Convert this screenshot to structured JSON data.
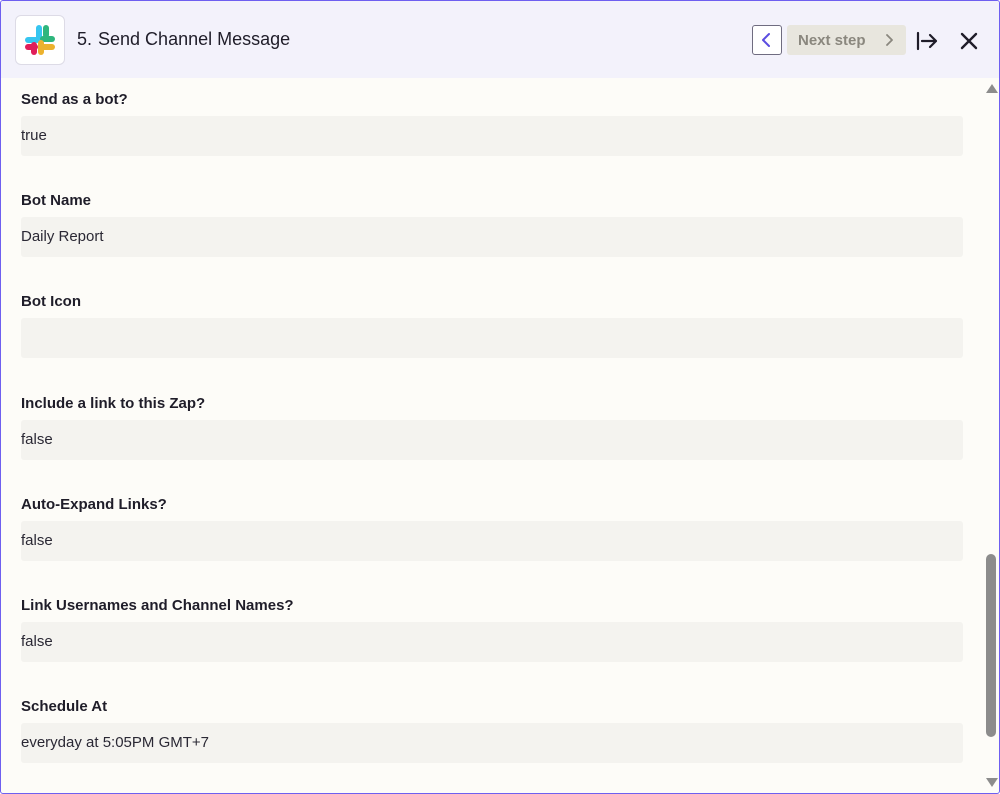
{
  "header": {
    "step_number": "5.",
    "step_title": "Send Channel Message",
    "next_label": "Next step",
    "app_icon": "slack-logo"
  },
  "fields": [
    {
      "label": "Send as a bot?",
      "value": "true"
    },
    {
      "label": "Bot Name",
      "value": "Daily Report"
    },
    {
      "label": "Bot Icon",
      "value": ""
    },
    {
      "label": "Include a link to this Zap?",
      "value": "false"
    },
    {
      "label": "Auto-Expand Links?",
      "value": "false"
    },
    {
      "label": "Link Usernames and Channel Names?",
      "value": "false"
    },
    {
      "label": "Schedule At",
      "value": "everyday at 5:05PM GMT+7"
    }
  ],
  "colors": {
    "accent": "#6e5ff0",
    "header_bg": "#f3f2fb",
    "panel_bg": "#fdfcf8",
    "field_bg": "#f4f3ef"
  }
}
